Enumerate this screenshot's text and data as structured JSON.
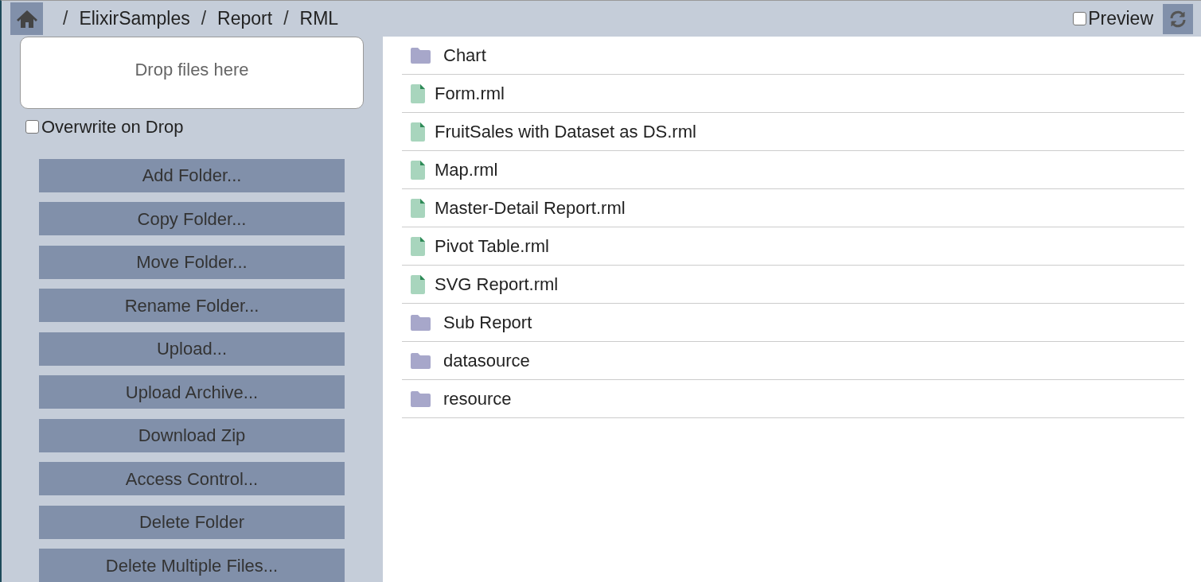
{
  "breadcrumb": [
    {
      "kind": "separator",
      "text": "/"
    },
    {
      "kind": "link",
      "text": "ElixirSamples"
    },
    {
      "kind": "separator",
      "text": "/"
    },
    {
      "kind": "link",
      "text": "Report"
    },
    {
      "kind": "separator",
      "text": "/"
    },
    {
      "kind": "link",
      "text": "RML"
    }
  ],
  "preview": {
    "label": "Preview",
    "checked": false
  },
  "dropzone": {
    "text": "Drop files here"
  },
  "overwrite": {
    "label": "Overwrite on Drop",
    "checked": false
  },
  "actions": [
    "Add Folder...",
    "Copy Folder...",
    "Move Folder...",
    "Rename Folder...",
    "Upload...",
    "Upload Archive...",
    "Download Zip",
    "Access Control...",
    "Delete Folder",
    "Delete Multiple Files..."
  ],
  "files": [
    {
      "kind": "folder",
      "name": "Chart"
    },
    {
      "kind": "file",
      "name": "Form.rml"
    },
    {
      "kind": "file",
      "name": "FruitSales with Dataset as DS.rml"
    },
    {
      "kind": "file",
      "name": "Map.rml"
    },
    {
      "kind": "file",
      "name": "Master-Detail Report.rml"
    },
    {
      "kind": "file",
      "name": "Pivot Table.rml"
    },
    {
      "kind": "file",
      "name": "SVG Report.rml"
    },
    {
      "kind": "folder",
      "name": "Sub Report"
    },
    {
      "kind": "folder",
      "name": "datasource"
    },
    {
      "kind": "folder",
      "name": "resource"
    }
  ]
}
